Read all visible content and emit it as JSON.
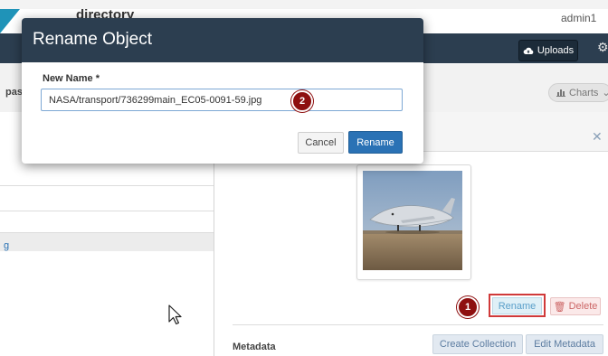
{
  "app": {
    "title": "directory",
    "user": "admin1",
    "uploads_label": "Uploads",
    "breadcrumb_fragment": "pas",
    "charts_label": "Charts",
    "left_item_fragment": "g"
  },
  "object": {
    "rename_label": "Rename",
    "delete_label": "Delete",
    "metadata_label": "Metadata",
    "create_collection_label": "Create Collection",
    "edit_metadata_label": "Edit Metadata"
  },
  "modal": {
    "title": "Rename Object",
    "field_label": "New Name *",
    "field_value": "NASA/transport/736299main_EC05-0091-59.jpg",
    "cancel_label": "Cancel",
    "submit_label": "Rename"
  },
  "annotations": {
    "step1": "1",
    "step2": "2",
    "badge_color": "#8e0f0f",
    "highlight_color": "#d03a3a"
  },
  "colors": {
    "navbar": "#2c3e50",
    "primary": "#2a72b5",
    "brand_accent": "#1f93b8"
  }
}
